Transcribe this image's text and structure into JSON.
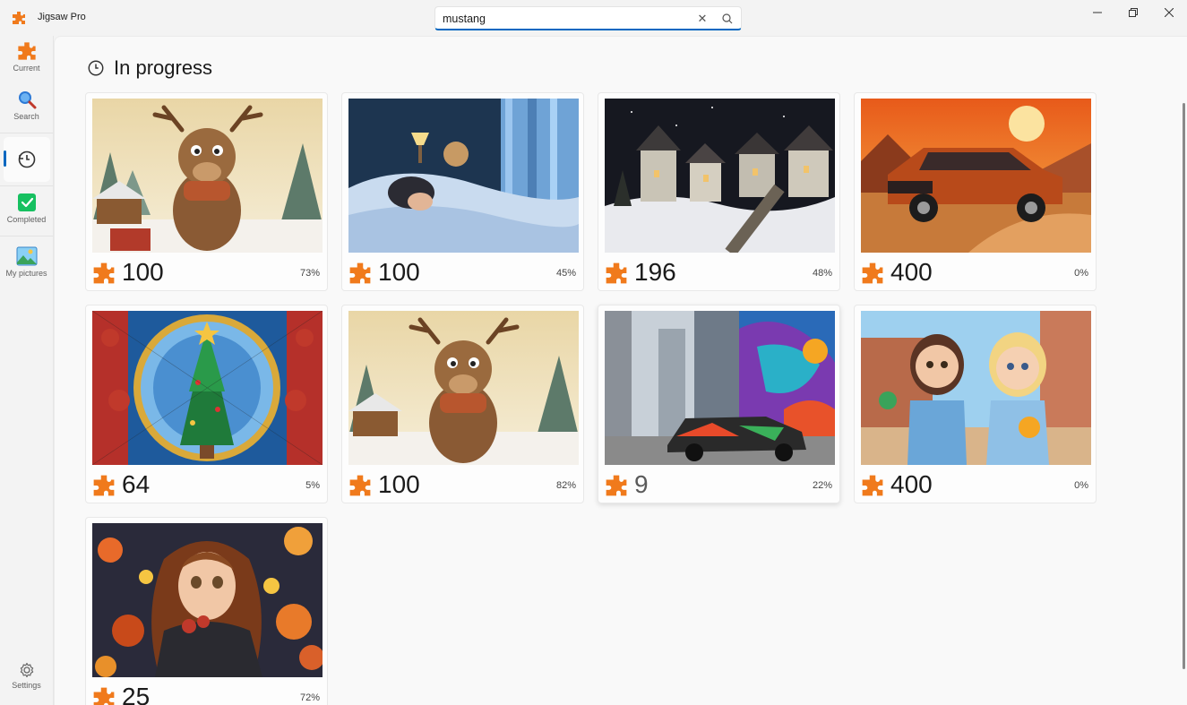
{
  "app": {
    "title": "Jigsaw Pro",
    "accent": "#0067c0",
    "brand_orange": "#f07a1c"
  },
  "search": {
    "value": "mustang",
    "placeholder": ""
  },
  "sidebar": {
    "items": [
      {
        "label": "Current",
        "icon": "puzzle-icon"
      },
      {
        "label": "Search",
        "icon": "magnifier-icon"
      },
      {
        "label": "",
        "icon": "history-clock-icon",
        "selected": true
      },
      {
        "label": "Completed",
        "icon": "check-icon"
      },
      {
        "label": "My pictures",
        "icon": "picture-icon"
      }
    ],
    "settings_label": "Settings"
  },
  "page": {
    "title": "In progress"
  },
  "puzzles": [
    {
      "pieces": "100",
      "progress": "73%",
      "image": "reindeer-snow"
    },
    {
      "pieces": "100",
      "progress": "45%",
      "image": "child-sleeping"
    },
    {
      "pieces": "196",
      "progress": "48%",
      "image": "winter-village-night"
    },
    {
      "pieces": "400",
      "progress": "0%",
      "image": "orange-mustang-sunset"
    },
    {
      "pieces": "64",
      "progress": "5%",
      "image": "stained-glass-christmas-tree"
    },
    {
      "pieces": "100",
      "progress": "82%",
      "image": "reindeer-snow"
    },
    {
      "pieces": "9",
      "progress": "22%",
      "image": "graffiti-sports-car"
    },
    {
      "pieces": "400",
      "progress": "0%",
      "image": "cartoon-girls"
    },
    {
      "pieces": "25",
      "progress": "72%",
      "image": "autumn-girl"
    }
  ]
}
